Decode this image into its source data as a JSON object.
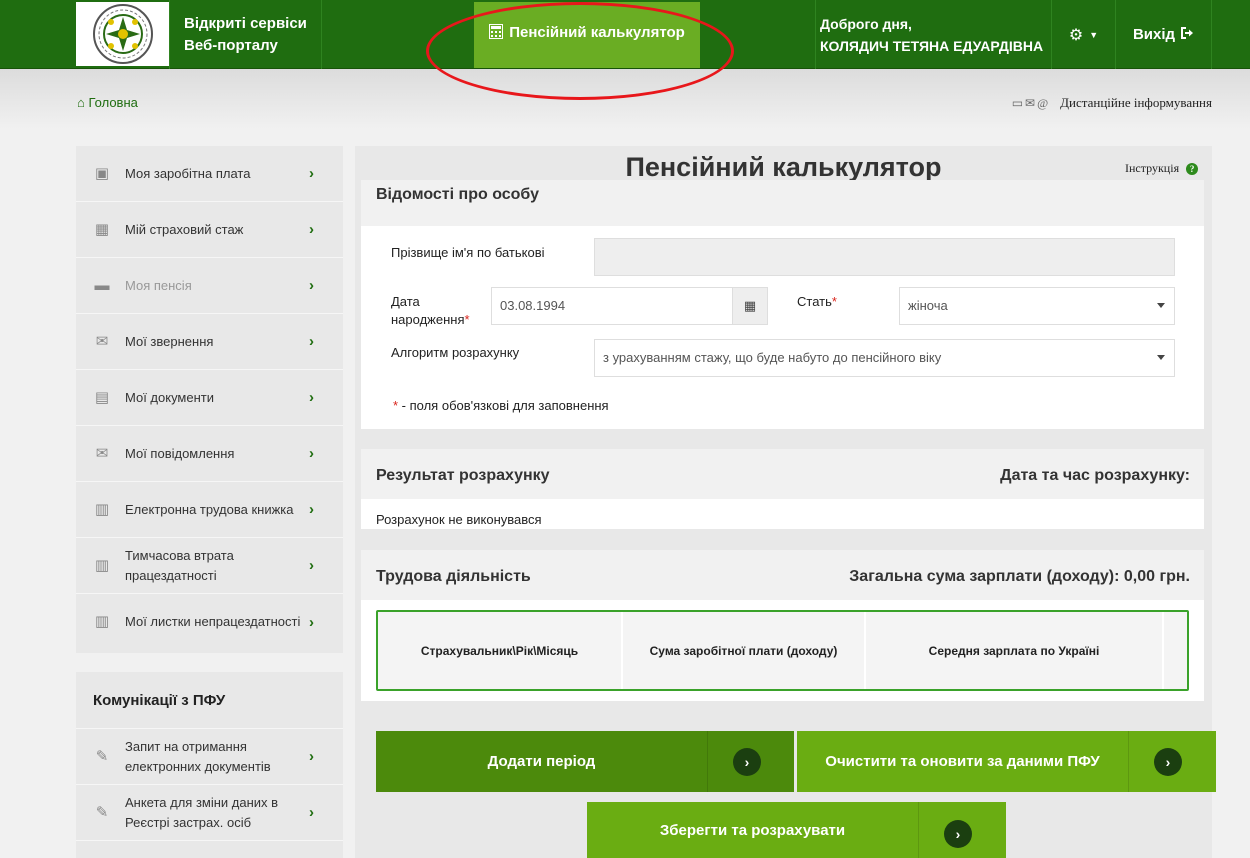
{
  "header": {
    "portal_title_line1": "Відкриті сервіси",
    "portal_title_line2": "Веб-порталу",
    "calc_tab_label": "Пенсійний калькулятор",
    "greeting_line1": "Доброго дня,",
    "greeting_line2": "КОЛЯДИЧ ТЕТЯНА ЕДУАРДІВНА",
    "exit_label": "Вихід"
  },
  "breadcrumb": {
    "home_label": "Головна"
  },
  "remote_info_label": "Дистанційне інформування",
  "sidebar": {
    "items": [
      {
        "label": "Моя заробітна плата",
        "icon": "wallet-icon"
      },
      {
        "label": "Мій страховий стаж",
        "icon": "calendar-icon"
      },
      {
        "label": "Моя пенсія",
        "icon": "folder-icon"
      },
      {
        "label": "Мої звернення",
        "icon": "envelope-icon"
      },
      {
        "label": "Мої документи",
        "icon": "document-icon"
      },
      {
        "label": "Мої повідомлення",
        "icon": "mail-icon"
      },
      {
        "label": "Електронна трудова книжка",
        "icon": "book-icon"
      },
      {
        "label": "Тимчасова втрата працездатності",
        "icon": "book-icon"
      },
      {
        "label": "Мої листки непрацездатності",
        "icon": "book-icon"
      }
    ]
  },
  "communications": {
    "title": "Комунікації з ПФУ",
    "items": [
      {
        "label": "Запит на отримання електронних документів",
        "icon": "edit-doc-icon"
      },
      {
        "label": "Анкета для зміни даних в Реєстрі застрах. осіб",
        "icon": "edit-doc-icon"
      }
    ]
  },
  "main": {
    "title": "Пенсійний калькулятор",
    "instruction_label": "Інструкція",
    "person_section": {
      "title": "Відомості про особу",
      "full_name_label": "Прізвище ім'я по батькові",
      "full_name_value": "",
      "birth_date_label_line1": "Дата",
      "birth_date_label_line2": "народження",
      "birth_date_value": "03.08.1994",
      "gender_label": "Стать",
      "gender_value": "жіноча",
      "algorithm_label": "Алгоритм розрахунку",
      "algorithm_value": "з урахуванням стажу, що буде набуто до пенсійного віку",
      "required_note": " - поля обов'язкові для заповнення",
      "required_mark": "*"
    },
    "result_section": {
      "title": "Результат розрахунку",
      "datetime_label": "Дата та час розрахунку:",
      "status_text": "Розрахунок не виконувався"
    },
    "work_section": {
      "title": "Трудова діяльність",
      "total_label": "Загальна сума зарплати (доходу): 0,00 грн.",
      "columns": [
        "Страхувальник\\Рік\\Місяць",
        "Сума заробітної плати (доходу)",
        "Середня зарплата по Україні"
      ]
    },
    "buttons": {
      "add_period": "Додати період",
      "clear_refresh": "Очистити та оновити за даними ПФУ",
      "save_calculate": "Зберегти та розрахувати"
    }
  },
  "colors": {
    "header_green": "#1f6d10",
    "tab_active": "#6aad23",
    "button_dark": "#4c8a0c",
    "button_light": "#6aad12",
    "annotation_red": "#e8171b"
  }
}
